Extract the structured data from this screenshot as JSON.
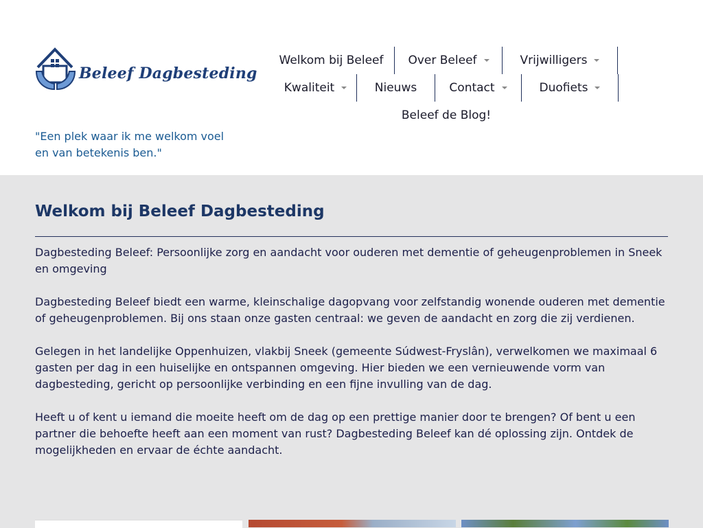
{
  "logo": {
    "text": "Beleef Dagbesteding",
    "icon": "house-in-hands-icon"
  },
  "tagline": "\"Een plek waar ik me welkom voel en van betekenis ben.\"",
  "nav": {
    "welkom": "Welkom bij Beleef",
    "over": "Over Beleef",
    "vrijwilligers": "Vrijwilligers",
    "kwaliteit": "Kwaliteit",
    "nieuws": "Nieuws",
    "contact": "Contact",
    "duofiets": "Duofiets",
    "blog": "Beleef de Blog!"
  },
  "main": {
    "title": "Welkom bij Beleef Dagbesteding",
    "paragraphs": [
      "Dagbesteding Beleef: Persoonlijke zorg en aandacht voor ouderen met dementie of geheugenproblemen in Sneek en omgeving",
      "Dagbesteding Beleef biedt een warme, kleinschalige dagopvang voor zelfstandig wonende ouderen met dementie of geheugenproblemen. Bij ons staan onze gasten centraal: we geven de aandacht en zorg die zij verdienen.",
      "Gelegen in het landelijke Oppenhuizen, vlakbij Sneek (gemeente Súdwest-Fryslân), verwelkomen we maximaal 6 gasten per dag in een huiselijke en ontspannen omgeving. Hier bieden we een vernieuwende vorm van dagbesteding, gericht op persoonlijke verbinding en een fijne invulling van de dag.",
      "Heeft u of kent u iemand die moeite heeft om de dag op een prettige manier door te brengen? Of bent u een partner die behoefte heeft aan een moment van rust? Dagbesteding Beleef kan dé oplossing zijn. Ontdek de mogelijkheden en ervaar de échte aandacht."
    ]
  },
  "colors": {
    "header_bg": "#ffffff",
    "page_bg": "#e5e5e6",
    "title": "#1d3766",
    "tagline": "#1b5b93",
    "logo_blue": "#1f3f78"
  }
}
